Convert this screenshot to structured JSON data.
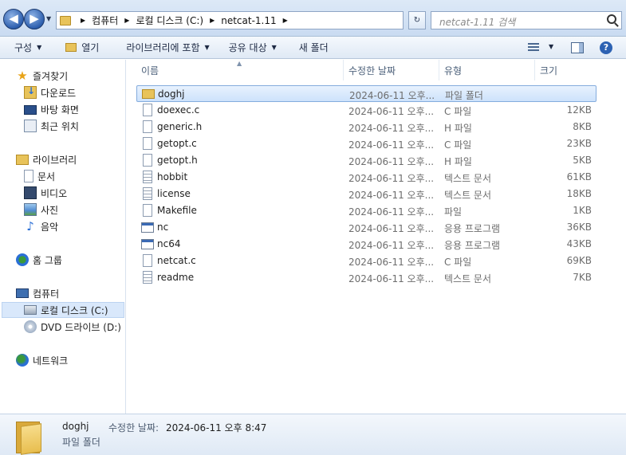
{
  "address": {
    "crumbs": [
      "컴퓨터",
      "로컬 디스크 (C:)",
      "netcat-1.11"
    ],
    "search_placeholder": "netcat-1.11 검색"
  },
  "toolbar": {
    "organize": "구성",
    "open": "열기",
    "include_library": "라이브러리에 포함",
    "share": "공유 대상",
    "new_folder": "새 폴더"
  },
  "nav": {
    "favorites": "즐겨찾기",
    "downloads": "다운로드",
    "desktop": "바탕 화면",
    "recent": "최근 위치",
    "libraries": "라이브러리",
    "documents": "문서",
    "videos": "비디오",
    "pictures": "사진",
    "music": "음악",
    "homegroup": "홈 그룹",
    "computer": "컴퓨터",
    "local_disk": "로컬 디스크 (C:)",
    "dvd": "DVD 드라이브 (D:)",
    "network": "네트워크"
  },
  "columns": {
    "name": "이름",
    "date": "수정한 날짜",
    "type": "유형",
    "size": "크기"
  },
  "files": [
    {
      "name": "doghj",
      "date": "2024-06-11 오후...",
      "type": "파일 폴더",
      "size": "",
      "icon": "folder-icon"
    },
    {
      "name": "doexec.c",
      "date": "2024-06-11 오후...",
      "type": "C 파일",
      "size": "12KB",
      "icon": "file-icon"
    },
    {
      "name": "generic.h",
      "date": "2024-06-11 오후...",
      "type": "H 파일",
      "size": "8KB",
      "icon": "file-icon"
    },
    {
      "name": "getopt.c",
      "date": "2024-06-11 오후...",
      "type": "C 파일",
      "size": "23KB",
      "icon": "file-icon"
    },
    {
      "name": "getopt.h",
      "date": "2024-06-11 오후...",
      "type": "H 파일",
      "size": "5KB",
      "icon": "file-icon"
    },
    {
      "name": "hobbit",
      "date": "2024-06-11 오후...",
      "type": "텍스트 문서",
      "size": "61KB",
      "icon": "text-file-icon"
    },
    {
      "name": "license",
      "date": "2024-06-11 오후...",
      "type": "텍스트 문서",
      "size": "18KB",
      "icon": "text-file-icon"
    },
    {
      "name": "Makefile",
      "date": "2024-06-11 오후...",
      "type": "파일",
      "size": "1KB",
      "icon": "file-icon"
    },
    {
      "name": "nc",
      "date": "2024-06-11 오후...",
      "type": "응용 프로그램",
      "size": "36KB",
      "icon": "exe-icon"
    },
    {
      "name": "nc64",
      "date": "2024-06-11 오후...",
      "type": "응용 프로그램",
      "size": "43KB",
      "icon": "exe-icon"
    },
    {
      "name": "netcat.c",
      "date": "2024-06-11 오후...",
      "type": "C 파일",
      "size": "69KB",
      "icon": "file-icon"
    },
    {
      "name": "readme",
      "date": "2024-06-11 오후...",
      "type": "텍스트 문서",
      "size": "7KB",
      "icon": "text-file-icon"
    }
  ],
  "details": {
    "name": "doghj",
    "date_label": "수정한 날짜:",
    "date": "2024-06-11 오후 8:47",
    "type": "파일 폴더"
  },
  "colors": {
    "selection": "#cde2fb",
    "toolbar_bg": "#dfe9f5"
  }
}
